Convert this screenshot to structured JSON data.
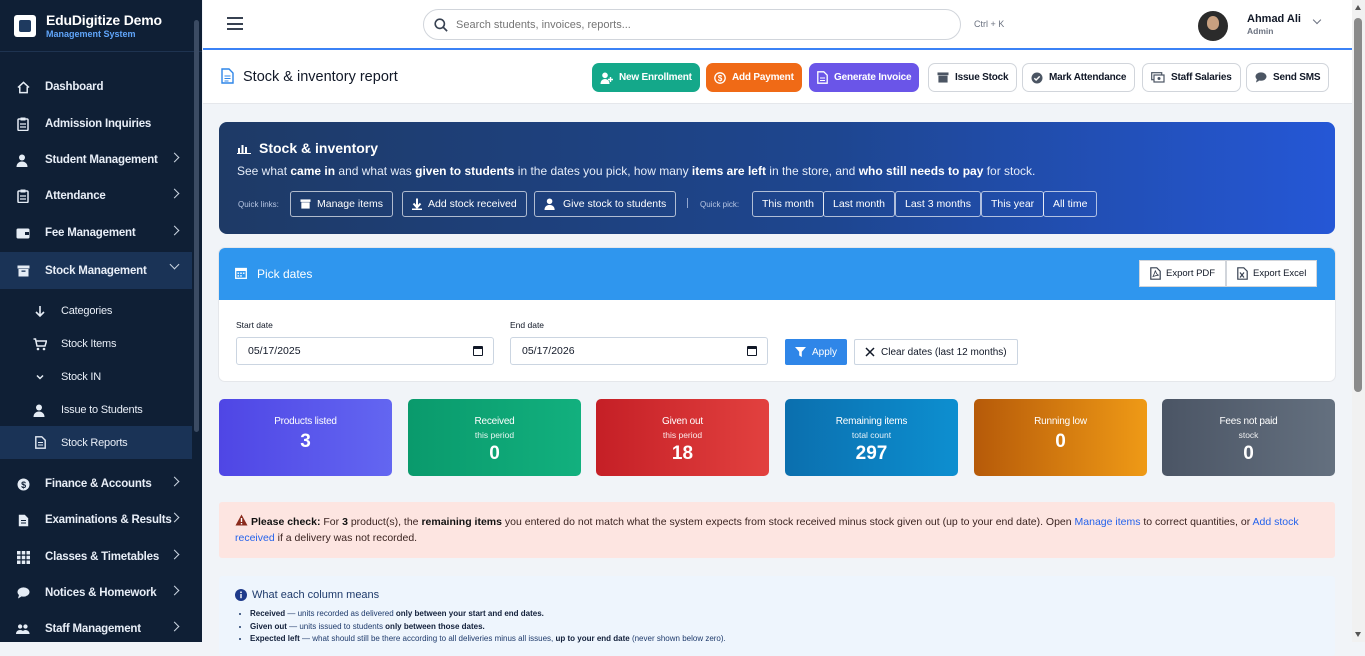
{
  "brand": {
    "title": "EduDigitize Demo",
    "subtitle": "Management System"
  },
  "sidebar": {
    "items": [
      {
        "label": "Dashboard",
        "icon": "home-icon"
      },
      {
        "label": "Admission Inquiries",
        "icon": "clipboard-icon"
      },
      {
        "label": "Student Management",
        "icon": "user-icon"
      },
      {
        "label": "Attendance",
        "icon": "clipboard-icon"
      },
      {
        "label": "Fee Management",
        "icon": "wallet-icon"
      },
      {
        "label": "Stock Management",
        "icon": "box-icon"
      },
      {
        "label": "Finance & Accounts",
        "icon": "dollar-icon"
      },
      {
        "label": "Examinations & Results",
        "icon": "document-icon"
      },
      {
        "label": "Classes & Timetables",
        "icon": "grid-icon"
      },
      {
        "label": "Notices & Homework",
        "icon": "chat-icon"
      },
      {
        "label": "Staff Management",
        "icon": "users-icon"
      }
    ],
    "sub_items": [
      {
        "label": "Categories",
        "icon": "arrow-down-icon"
      },
      {
        "label": "Stock Items",
        "icon": "cart-icon"
      },
      {
        "label": "Stock IN",
        "icon": "chevron-down-icon"
      },
      {
        "label": "Issue to Students",
        "icon": "user-icon"
      },
      {
        "label": "Stock Reports",
        "icon": "document-icon"
      }
    ]
  },
  "search": {
    "placeholder": "Search students, invoices, reports...",
    "shortcut": "Ctrl + K"
  },
  "user": {
    "name": "Ahmad Ali",
    "role": "Admin"
  },
  "page": {
    "title": "Stock & inventory report"
  },
  "quick_actions": [
    {
      "label": "New Enrollment",
      "color": "#14a88a"
    },
    {
      "label": "Add Payment",
      "color": "#f06a16"
    },
    {
      "label": "Generate Invoice",
      "color": "#6a55e8"
    },
    {
      "label": "Issue Stock"
    },
    {
      "label": "Mark Attendance"
    },
    {
      "label": "Staff Salaries"
    },
    {
      "label": "Send SMS"
    }
  ],
  "hero": {
    "title": "Stock & inventory",
    "desc_parts": [
      "See what ",
      "came in",
      " and what was ",
      "given to students",
      " in the dates you pick, how many ",
      "items are left",
      " in the store, and ",
      "who still needs to pay",
      " for stock."
    ],
    "quick_links_label": "Quick links:",
    "quick_links": [
      "Manage items",
      "Add stock received",
      "Give stock to students"
    ],
    "quick_pick_label": "Quick pick:",
    "quick_pick": [
      "This month",
      "Last month",
      "Last 3 months",
      "This year",
      "All time"
    ]
  },
  "filter": {
    "title": "Pick dates",
    "export_pdf": "Export PDF",
    "export_excel": "Export Excel",
    "start_label": "Start date",
    "start_value": "05/17/2025",
    "end_label": "End date",
    "end_value": "05/17/2026",
    "apply": "Apply",
    "clear": "Clear dates (last 12 months)"
  },
  "stats": [
    {
      "label": "Products listed",
      "sub": "",
      "value": "3",
      "color1": "#4f46e5",
      "color2": "#6366f1"
    },
    {
      "label": "Received",
      "sub": "this period",
      "value": "0",
      "color1": "#0a9a6c",
      "color2": "#12b07e"
    },
    {
      "label": "Given out",
      "sub": "this period",
      "value": "18",
      "color1": "#c51f26",
      "color2": "#e2413f"
    },
    {
      "label": "Remaining items",
      "sub": "total count",
      "value": "297",
      "color1": "#0b6fae",
      "color2": "#0d8fd0"
    },
    {
      "label": "Running low",
      "sub": "",
      "value": "0",
      "color1": "#b65a09",
      "color2": "#ef9a16"
    },
    {
      "label": "Fees not paid",
      "sub": "stock",
      "value": "0",
      "color1": "#4b5565",
      "color2": "#64707f"
    }
  ],
  "alert": {
    "lead": "Please check:",
    "t1": " For ",
    "count": "3",
    "t2": " product(s), the ",
    "bold": "remaining items",
    "t3": " you entered do not match what the system expects from stock received minus stock given out (up to your end date). Open ",
    "link1": "Manage items",
    "t4": " to correct quantities, or ",
    "link2": "Add stock received",
    "t5": " if a delivery was not recorded."
  },
  "legend": {
    "title": "What each column means",
    "rows": [
      {
        "term": "Received",
        "text": " — units recorded as delivered ",
        "bold": "only between your start and end dates.",
        "tail": ""
      },
      {
        "term": "Given out",
        "text": " — units issued to students ",
        "bold": "only between those dates.",
        "tail": ""
      },
      {
        "term": "Expected left",
        "text": " — what should still be there according to all deliveries minus all issues, ",
        "bold": "up to your end date",
        "tail": " (never shown below zero)."
      }
    ]
  }
}
